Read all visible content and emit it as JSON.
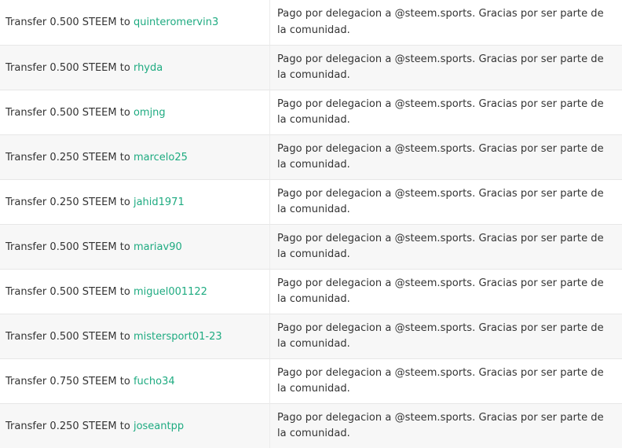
{
  "transfers": [
    {
      "prefix": "Transfer",
      "amount": "0.500 STEEM",
      "to_word": "to",
      "account": "quinteromervin3",
      "memo": "Pago por delegacion a @steem.sports. Gracias por ser parte de la comunidad."
    },
    {
      "prefix": "Transfer",
      "amount": "0.500 STEEM",
      "to_word": "to",
      "account": "rhyda",
      "memo": "Pago por delegacion a @steem.sports. Gracias por ser parte de la comunidad."
    },
    {
      "prefix": "Transfer",
      "amount": "0.500 STEEM",
      "to_word": "to",
      "account": "omjng",
      "memo": "Pago por delegacion a @steem.sports. Gracias por ser parte de la comunidad."
    },
    {
      "prefix": "Transfer",
      "amount": "0.250 STEEM",
      "to_word": "to",
      "account": "marcelo25",
      "memo": "Pago por delegacion a @steem.sports. Gracias por ser parte de la comunidad."
    },
    {
      "prefix": "Transfer",
      "amount": "0.250 STEEM",
      "to_word": "to",
      "account": "jahid1971",
      "memo": "Pago por delegacion a @steem.sports. Gracias por ser parte de la comunidad."
    },
    {
      "prefix": "Transfer",
      "amount": "0.500 STEEM",
      "to_word": "to",
      "account": "mariav90",
      "memo": "Pago por delegacion a @steem.sports. Gracias por ser parte de la comunidad."
    },
    {
      "prefix": "Transfer",
      "amount": "0.500 STEEM",
      "to_word": "to",
      "account": "miguel001122",
      "memo": "Pago por delegacion a @steem.sports. Gracias por ser parte de la comunidad."
    },
    {
      "prefix": "Transfer",
      "amount": "0.500 STEEM",
      "to_word": "to",
      "account": "mistersport01-23",
      "memo": "Pago por delegacion a @steem.sports. Gracias por ser parte de la comunidad."
    },
    {
      "prefix": "Transfer",
      "amount": "0.750 STEEM",
      "to_word": "to",
      "account": "fucho34",
      "memo": "Pago por delegacion a @steem.sports. Gracias por ser parte de la comunidad."
    },
    {
      "prefix": "Transfer",
      "amount": "0.250 STEEM",
      "to_word": "to",
      "account": "joseantpp",
      "memo": "Pago por delegacion a @steem.sports. Gracias por ser parte de la comunidad."
    }
  ],
  "colors": {
    "account_link": "#1fab81",
    "row_alt_background": "#f7f7f7",
    "text": "#333333"
  }
}
